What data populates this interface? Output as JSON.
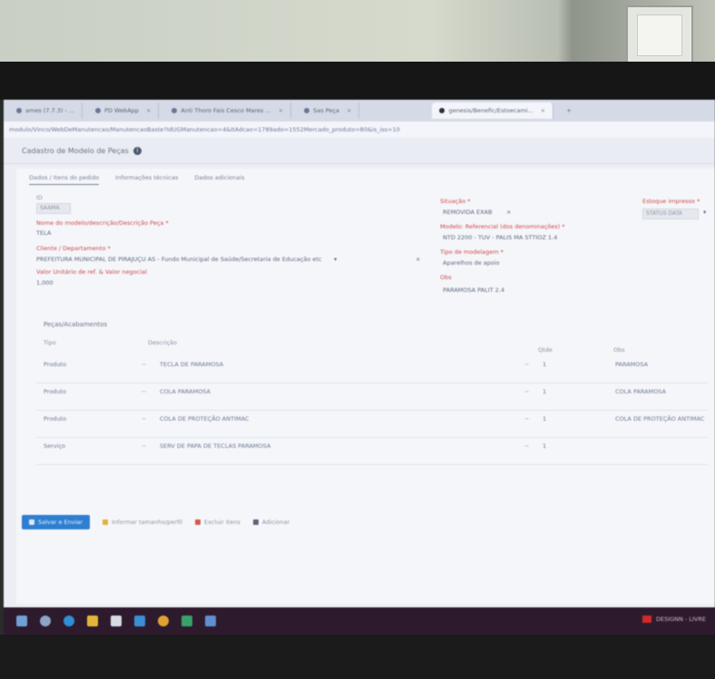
{
  "browser": {
    "tabs": [
      {
        "label": "ames (7.7.3) - ...",
        "active": false
      },
      {
        "label": "PD WebApp",
        "active": false
      },
      {
        "label": "Anti Thoro Fais Cesco Mares ...",
        "active": false
      },
      {
        "label": "Sas Peça",
        "active": false
      },
      {
        "label": "genesis/Benefic/Estoecami...",
        "active": true
      }
    ],
    "address": "modulo/Vinco/WebDeManutencao/ManutencaoBaste?IdUGManutencao=4&ItAdcao=1789ado=1552Mercado_produto=80&is_iss=10"
  },
  "page": {
    "title": "Cadastro de Modelo de Peças",
    "subtabs": [
      "Dados / Itens do pedido",
      "Informações técnicas",
      "Dados adicionais"
    ],
    "fields": {
      "id_label": "ID",
      "id_value": "SAAMA",
      "nome_label": "Nome do modelo/descrição/Descrição Peça *",
      "nome_value": "TELA",
      "cliente_label": "Cliente / Departamento *",
      "cliente_value": "PREFEITURA MUNICIPAL DE PIRAJUÇU AS - Fundo Municipal de Saúde/Secretaria de Educação etc",
      "valor_label": "Valor Unitário de ref. & Valor negocial",
      "valor_value": "1,000",
      "situacao_label": "Situação *",
      "situacao_value": "REMOVIDA EXAB",
      "estoque_label": "Estoque impresso *",
      "estoque_value": "STATUS DATA",
      "modelo_label": "Modelo: Referencial (dos denominações) *",
      "modelo_value": "NTD 2200 - TUV - PALIS MA STTIOZ 1.4",
      "tipo_label": "Tipo de modelagem *",
      "tipo_value": "Aparelhos de apoio",
      "obs_label": "Obs",
      "obs_value": "PARAMOSA PALIT 2.4"
    },
    "composition": {
      "title": "Peças/Acabamentos",
      "headers": {
        "type": "Tipo",
        "product": "Descrição",
        "qty": "Qtde",
        "obs": "Obs"
      },
      "rows": [
        {
          "type": "Produto",
          "product": "TECLA DE PARAMOSA",
          "qty": "1",
          "obs": "PARAMOSA"
        },
        {
          "type": "Produto",
          "product": "COLA PARAMOSA",
          "qty": "1",
          "obs": "COLA PARAMOSA"
        },
        {
          "type": "Produto",
          "product": "COLA DE PROTEÇÃO ANTIMAC",
          "qty": "1",
          "obs": "COLA DE PROTEÇÃO ANTIMAC"
        },
        {
          "type": "Serviço",
          "product": "SERV DE PAPA DE TECLAS PARAMOSA",
          "qty": "1",
          "obs": ""
        }
      ]
    },
    "actions": {
      "save": "Salvar e Enviar",
      "inform": "Informar tamanho/perfil",
      "remove": "Excluir itens",
      "add": "Adicionar"
    }
  },
  "taskbar": {
    "right_label": "DESIGNN - LIVRE"
  },
  "colors": {
    "accent": "#2f7fd1",
    "required_label": "#d04a4a",
    "taskbar": "#2e1a2d"
  }
}
